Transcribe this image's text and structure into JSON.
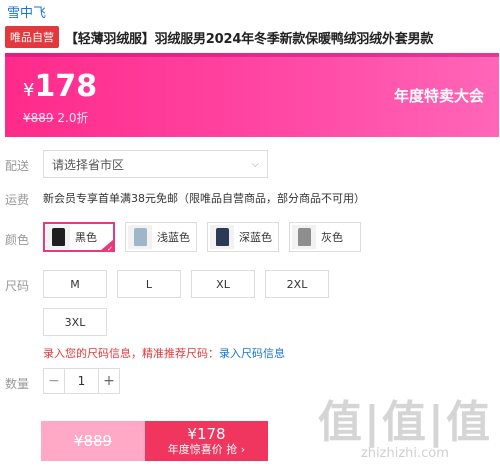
{
  "brand": "雪中飞",
  "title": {
    "badge": "唯品自营",
    "text": "【轻薄羽绒服】羽绒服男2024年冬季新款保暖鸭绒羽绒外套男款"
  },
  "promo": {
    "currency": "¥",
    "price": "178",
    "original_price": "¥889",
    "discount": "2.0折",
    "event_label": "年度特卖大会",
    "colors": {
      "start": "#ff2a8a",
      "end": "#ff66b8"
    }
  },
  "delivery": {
    "label": "配送",
    "placeholder": "请选择省市区"
  },
  "shipping": {
    "label": "运费",
    "text": "新会员专享首单满38元免邮（限唯品自营商品，部分商品不可用）"
  },
  "color": {
    "label": "颜色",
    "options": [
      {
        "name": "黑色",
        "swatch": "#1f1f1f",
        "selected": true
      },
      {
        "name": "浅蓝色",
        "swatch": "#9fb6c9",
        "selected": false
      },
      {
        "name": "深蓝色",
        "swatch": "#2b3a55",
        "selected": false
      },
      {
        "name": "灰色",
        "swatch": "#8e8e8e",
        "selected": false
      }
    ]
  },
  "size": {
    "label": "尺码",
    "options": [
      "M",
      "L",
      "XL",
      "2XL",
      "3XL"
    ],
    "hint": "录入您的尺码信息，精准推荐尺码：",
    "hint_link": "录入尺码信息"
  },
  "quantity": {
    "label": "数量",
    "value": "1",
    "minus": "−",
    "plus": "+"
  },
  "buy_button": {
    "original_price": "¥889",
    "price": "¥178",
    "text": "年度惊喜价 抢 ›"
  },
  "watermark": {
    "logo": "值|值|值",
    "url": "zhizhizhi.com"
  },
  "accent_color": "#e63a7a"
}
